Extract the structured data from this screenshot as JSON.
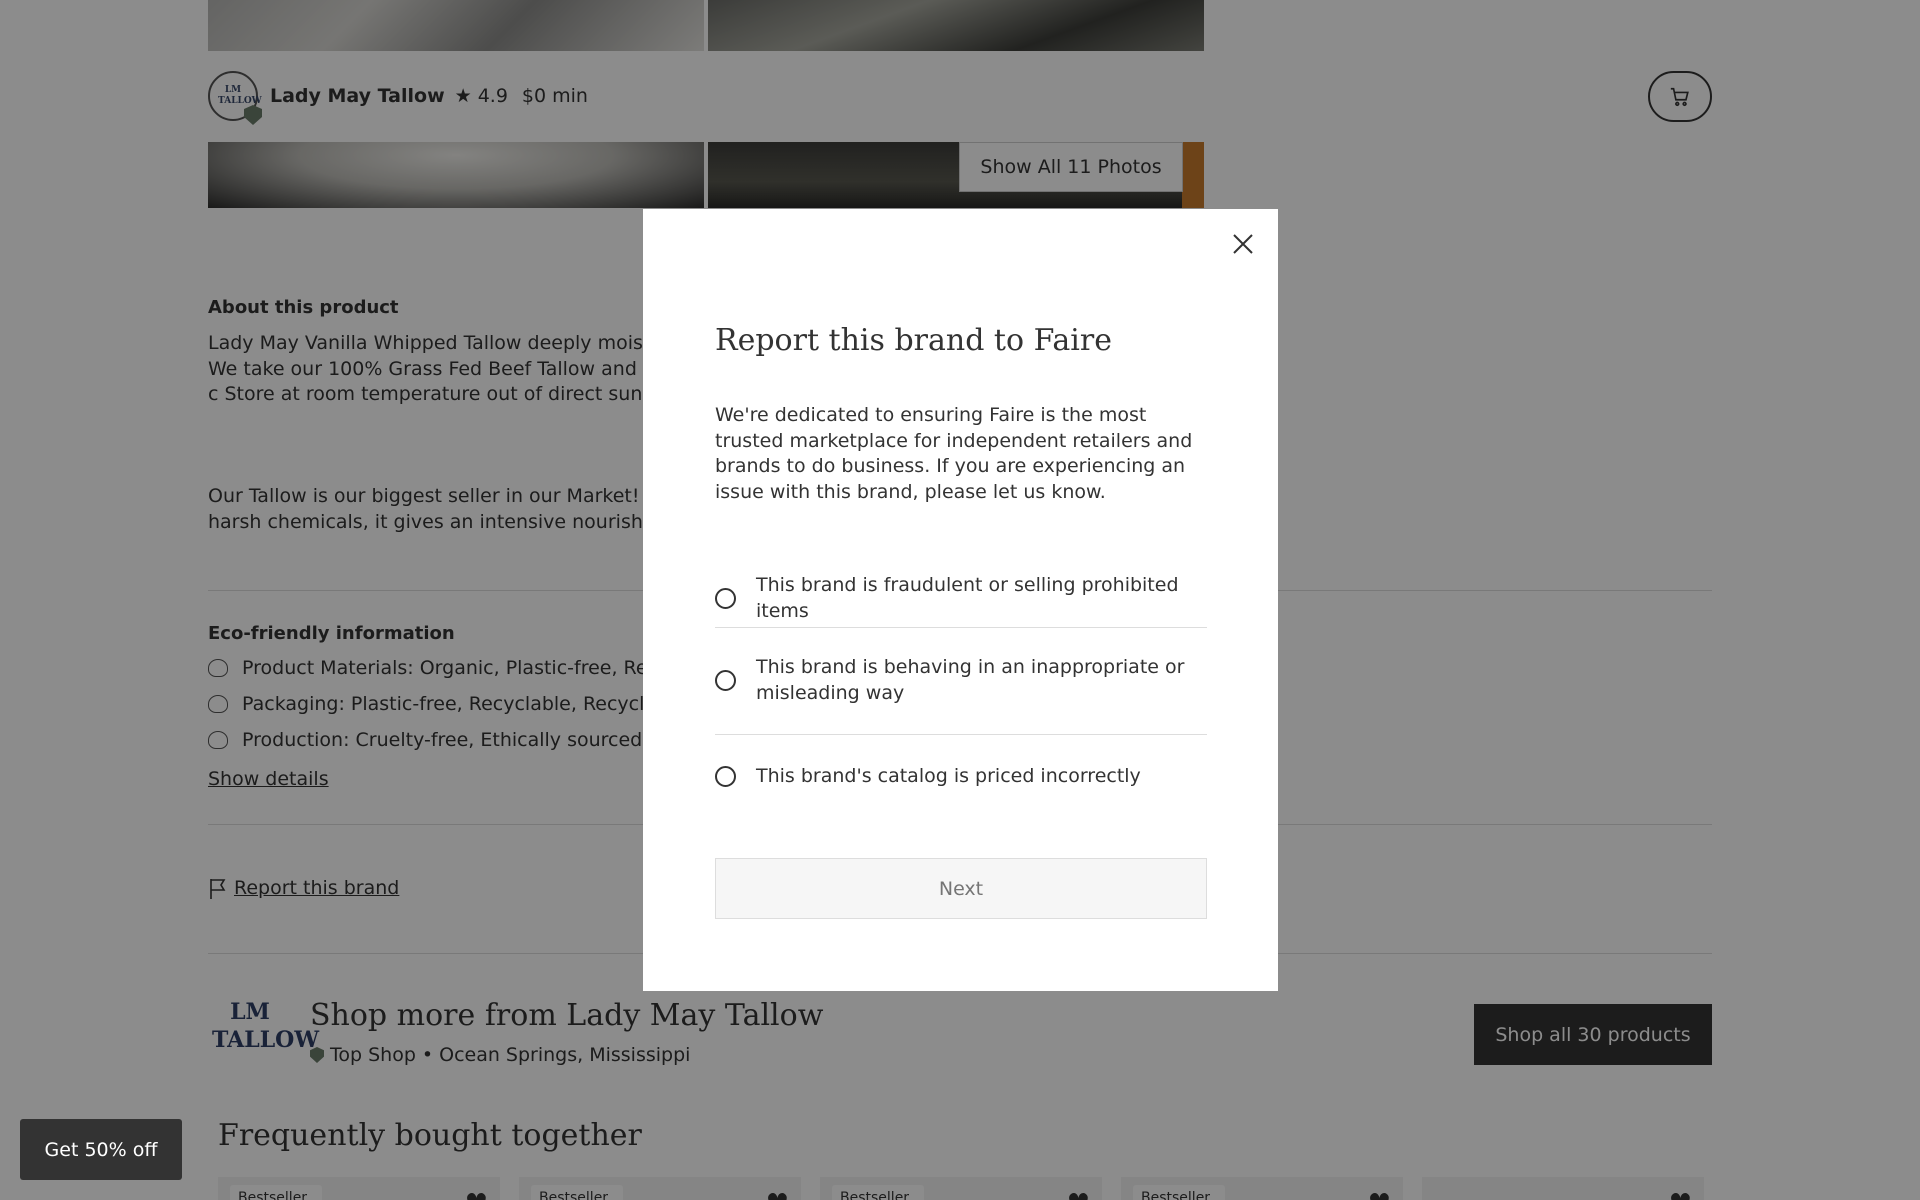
{
  "header": {
    "brand_name": "Lady May Tallow",
    "rating": "4.9",
    "minimum": "$0 min",
    "logo_text": "LM TALLOW",
    "show_photos_label": "Show All 11 Photos"
  },
  "about": {
    "heading": "About this product",
    "para1": "Lady May Vanilla Whipped Tallow deeply moisturize whole family. Perfect for sensitive skin, dry patches We take our 100% Grass Fed Beef Tallow and whip a your skin. Vanilla is from essential oil whipped into c Store at room temperature out of direct sunlight.",
    "para2": "Our Tallow is our biggest seller in our Market! We st know we are whipping it into a moisturizer. With no harsh chemicals, it gives an intensive nourishment t"
  },
  "eco": {
    "heading": "Eco-friendly information",
    "items": [
      {
        "icon": "materials-icon",
        "text": "Product Materials: Organic, Plastic-free, Recycl"
      },
      {
        "icon": "packaging-icon",
        "text": "Packaging: Plastic-free, Recyclable, Recycled, a"
      },
      {
        "icon": "production-icon",
        "text": "Production: Cruelty-free, Ethically sourced, Fair"
      }
    ],
    "show_details_label": "Show details"
  },
  "report_link_label": "Report this brand",
  "shop_more": {
    "title": "Shop more from Lady May Tallow",
    "badge": "Top Shop",
    "separator": "•",
    "location": "Ocean Springs, Mississippi",
    "shop_all_label": "Shop all 30 products",
    "logo_text": "LM TALLOW"
  },
  "frequently": {
    "title": "Frequently bought together",
    "card_badge": "Bestseller"
  },
  "promo_label": "Get 50% off",
  "modal": {
    "title": "Report this brand to Faire",
    "description": "We're dedicated to ensuring Faire is the most trusted marketplace for independent retailers and brands to do business. If you are experiencing an issue with this brand, please let us know.",
    "options": [
      "This brand is fraudulent or selling prohibited items",
      "This brand is behaving in an inappropriate or misleading way",
      "This brand's catalog is priced incorrectly"
    ],
    "next_label": "Next"
  }
}
